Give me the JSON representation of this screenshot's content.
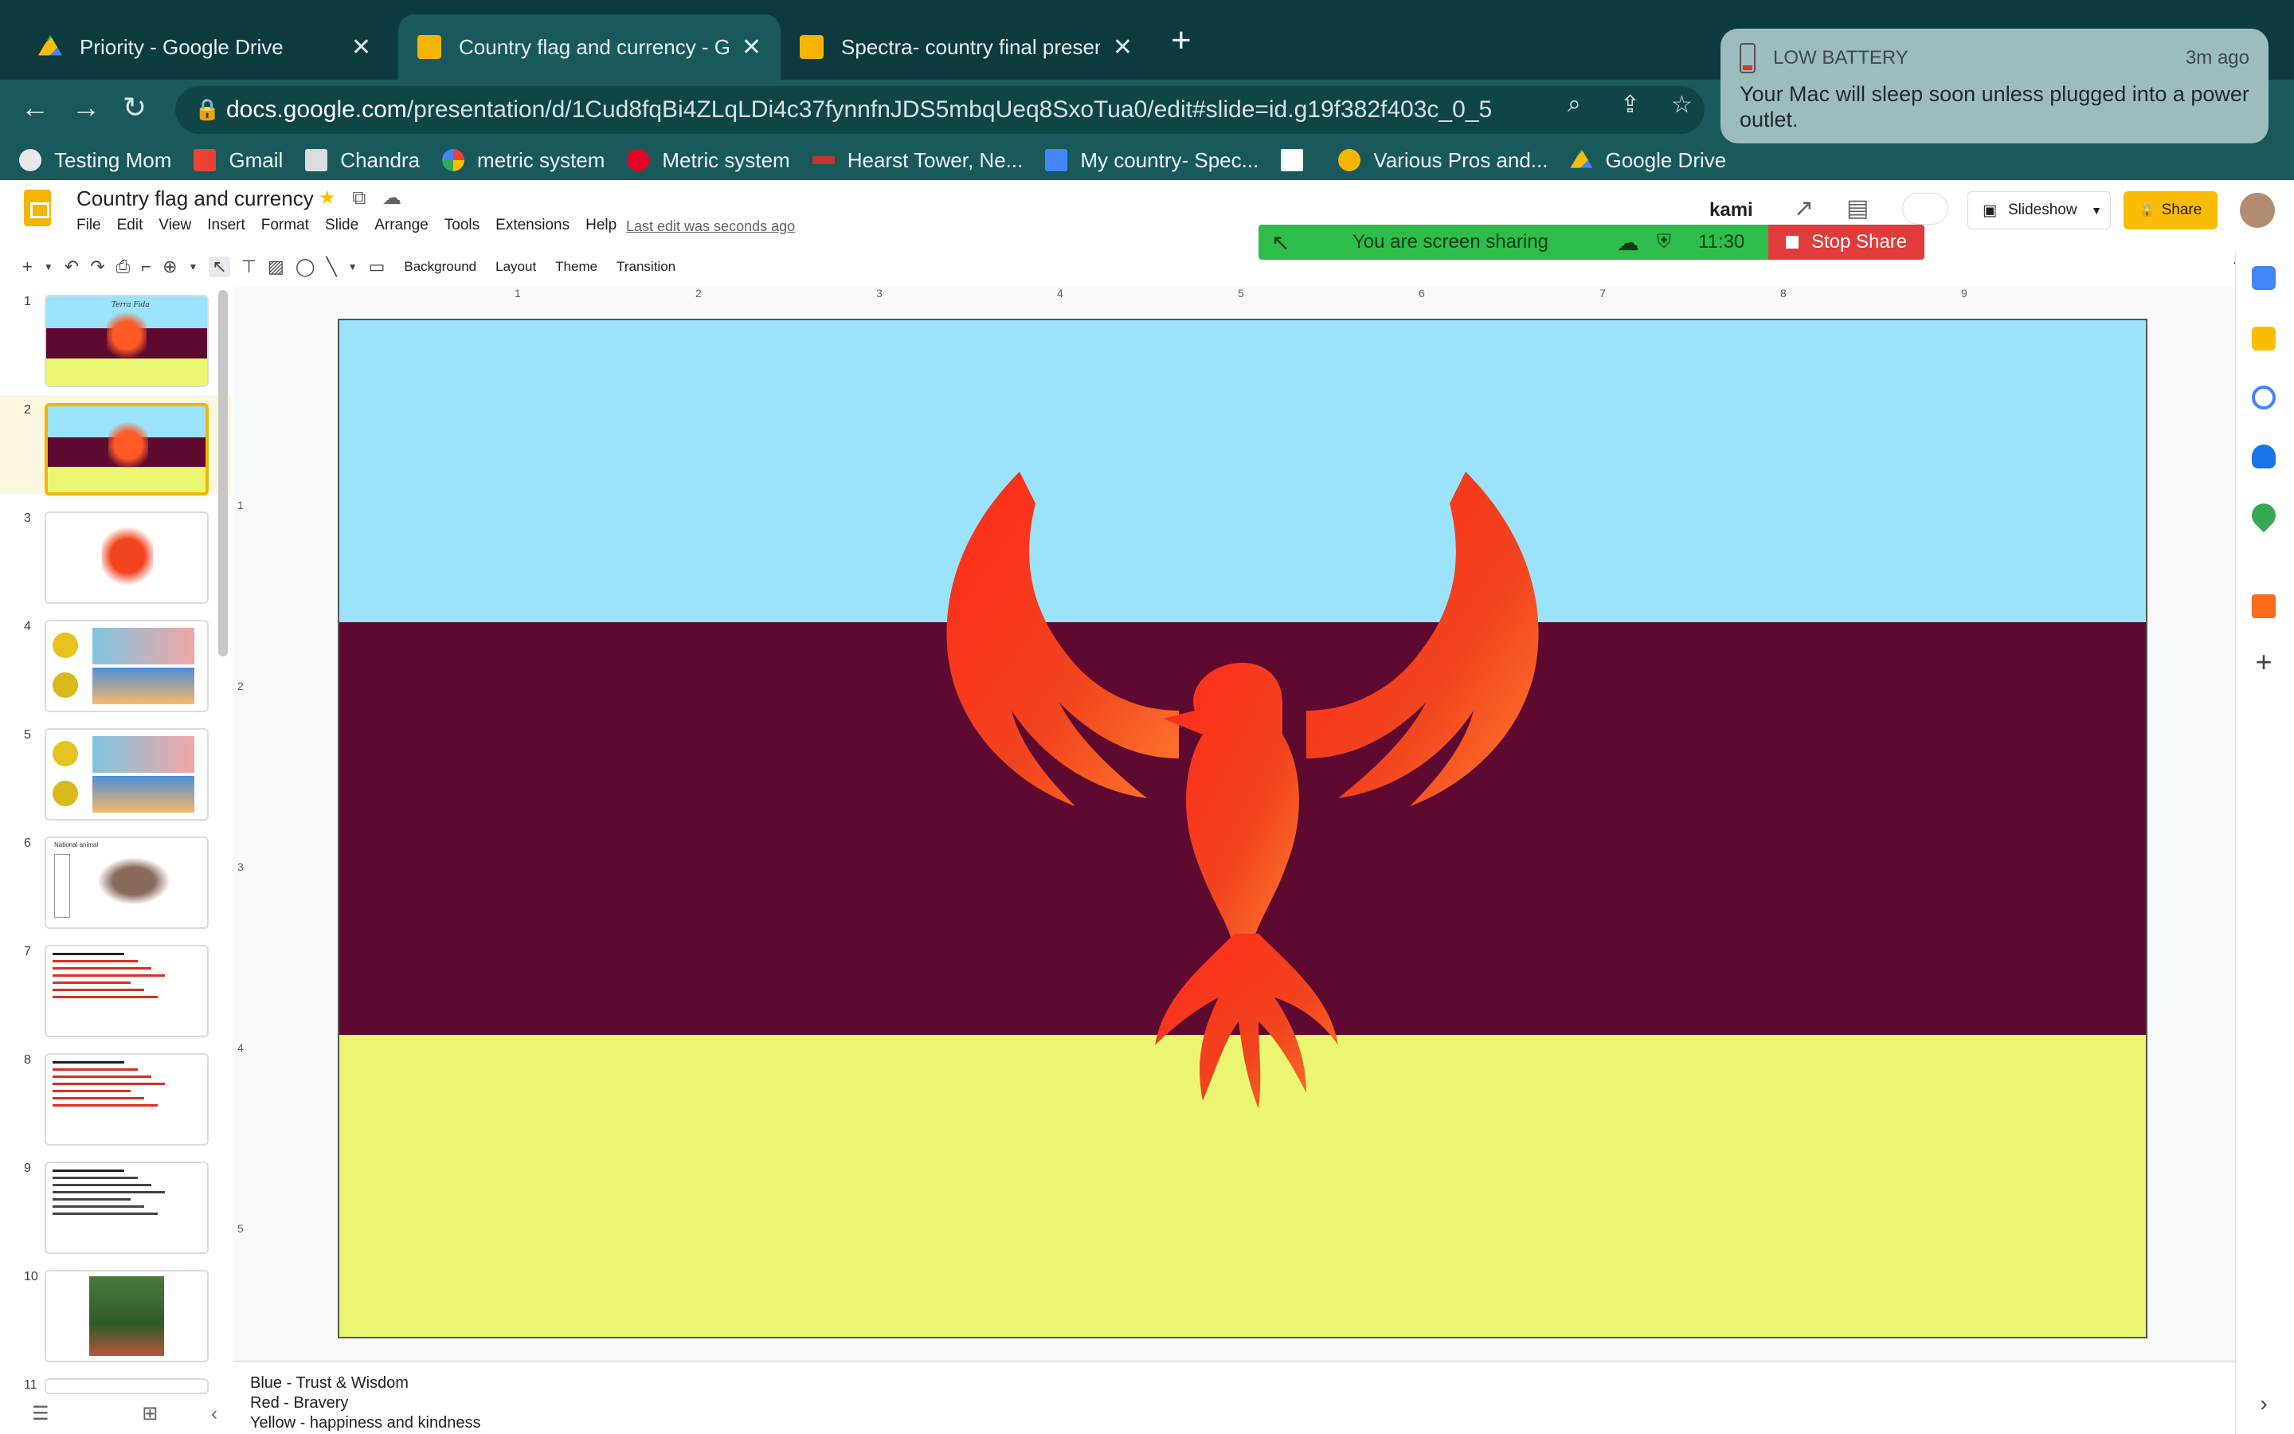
{
  "browser": {
    "tabs": [
      {
        "title": "Priority - Google Drive",
        "favicon": "google-drive-icon"
      },
      {
        "title": "Country flag and currency - Go",
        "favicon": "google-slides-icon"
      },
      {
        "title": "Spectra- country final presenta",
        "favicon": "google-slides-icon"
      }
    ],
    "close_glyph": "✕",
    "new_tab_glyph": "+",
    "url_host": "docs.google.com",
    "url_path": "/presentation/d/1Cud8fqBi4ZLqLDi4c37fynnfnJDS5mbqUeq8SxoTua0/edit#slide=id.g19f382f403c_0_5",
    "bookmarks": [
      {
        "label": "Testing Mom",
        "color": "#e8e8e8"
      },
      {
        "label": "Gmail",
        "color": "#ea4335"
      },
      {
        "label": "Chandra",
        "color": "#dddddd"
      },
      {
        "label": "metric system",
        "color": "#ffffff"
      },
      {
        "label": "Metric system",
        "color": "#e60023"
      },
      {
        "label": "Hearst Tower, Ne...",
        "color": "#c0392b"
      },
      {
        "label": "My country- Spec...",
        "color": "#4285f4"
      },
      {
        "label": "Various Pros and...",
        "color": "#f4b400"
      },
      {
        "label": "Google Drive",
        "color": "#34a853"
      }
    ]
  },
  "notification": {
    "title": "LOW BATTERY",
    "time": "3m ago",
    "message": "Your Mac will sleep soon unless plugged into a power outlet."
  },
  "document": {
    "title": "Country flag and currency",
    "menu": [
      "File",
      "Edit",
      "View",
      "Insert",
      "Format",
      "Slide",
      "Arrange",
      "Tools",
      "Extensions",
      "Help"
    ],
    "last_edit": "Last edit was seconds ago",
    "kami_label": "kami",
    "slideshow_label": "Slideshow",
    "share_label": "Share"
  },
  "screen_share": {
    "status": "You are screen sharing",
    "clock": "11:30",
    "stop_label": "Stop Share"
  },
  "toolbar": {
    "background_label": "Background",
    "layout_label": "Layout",
    "theme_label": "Theme",
    "transition_label": "Transition"
  },
  "ruler": {
    "top": [
      "1",
      "2",
      "3",
      "4",
      "5",
      "6",
      "7",
      "8",
      "9"
    ],
    "left": [
      "1",
      "2",
      "3",
      "4",
      "5"
    ]
  },
  "filmstrip": {
    "selected": 2,
    "slides": [
      {
        "num": "1",
        "kind": "flag-title",
        "caption": "Terra Fida"
      },
      {
        "num": "2",
        "kind": "flag"
      },
      {
        "num": "3",
        "kind": "phoenix"
      },
      {
        "num": "4",
        "kind": "currency"
      },
      {
        "num": "5",
        "kind": "currency"
      },
      {
        "num": "6",
        "kind": "animal",
        "caption": "National animal"
      },
      {
        "num": "7",
        "kind": "text-red"
      },
      {
        "num": "8",
        "kind": "text-red"
      },
      {
        "num": "9",
        "kind": "text-black"
      },
      {
        "num": "10",
        "kind": "photo"
      },
      {
        "num": "11",
        "kind": "partial"
      }
    ]
  },
  "slide": {
    "bands": [
      {
        "color": "#9be3fb",
        "share": 0.297
      },
      {
        "color": "#5e0a30",
        "share": 0.406
      },
      {
        "color": "#ebf772",
        "share": 0.297
      }
    ],
    "emblem": "phoenix-emblem"
  },
  "notes": {
    "lines": [
      "Blue - Trust & Wisdom",
      "Red - Bravery",
      "Yellow - happiness and kindness"
    ]
  },
  "colors": {
    "chrome_dark": "#0b3b3f",
    "chrome": "#19595c",
    "accent": "#fbbc04",
    "share_green": "#2ebd4a",
    "stop_red": "#e23b3b"
  }
}
